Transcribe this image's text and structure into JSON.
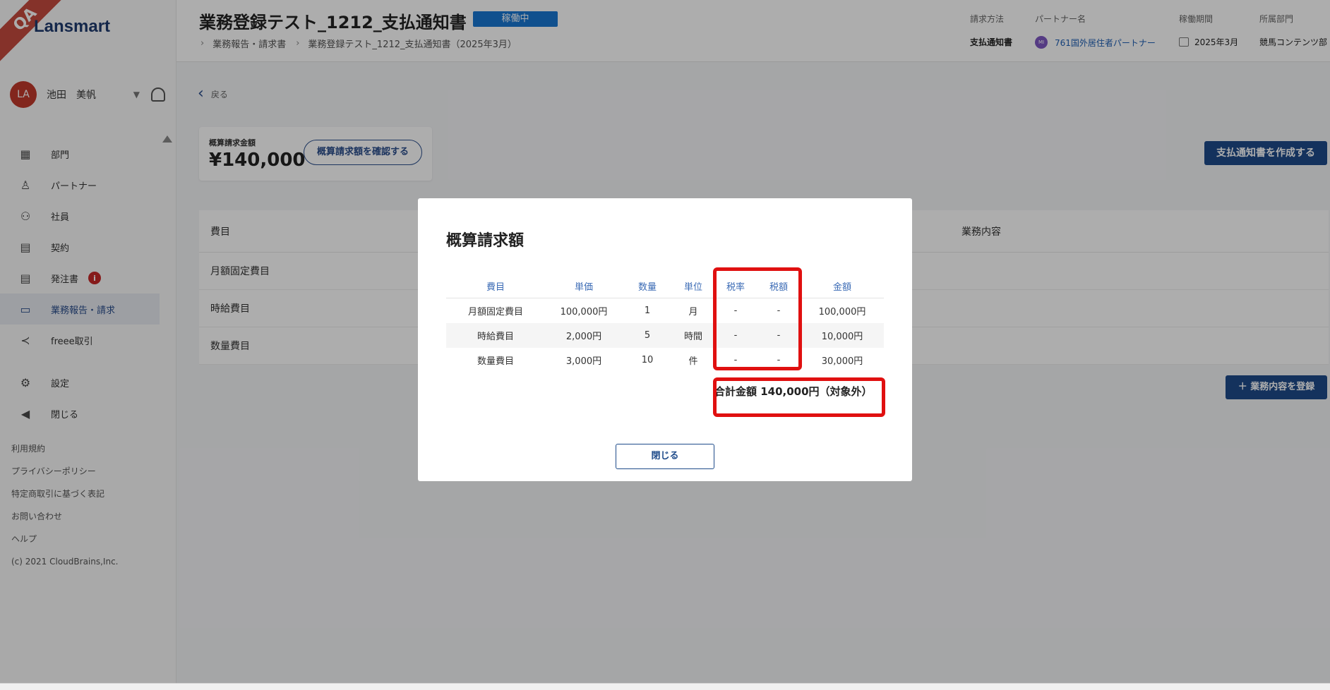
{
  "brand": {
    "ribbon": "QA",
    "name": "Lansmart"
  },
  "user": {
    "avatar": "LA",
    "name": "池田　美帆"
  },
  "nav": [
    {
      "label": "部門",
      "icon": "building-icon"
    },
    {
      "label": "パートナー",
      "icon": "person-icon"
    },
    {
      "label": "社員",
      "icon": "people-icon"
    },
    {
      "label": "契約",
      "icon": "document-icon"
    },
    {
      "label": "発注書",
      "icon": "document-icon",
      "badge": "i"
    },
    {
      "label": "業務報告・請求",
      "icon": "folder-icon",
      "active": true
    },
    {
      "label": "freee取引",
      "icon": "freee-icon"
    }
  ],
  "nav_bottom": [
    {
      "label": "設定",
      "icon": "gear-icon"
    },
    {
      "label": "閉じる",
      "icon": "collapse-icon"
    }
  ],
  "footer_links": [
    "利用規約",
    "プライバシーポリシー",
    "特定商取引に基づく表記",
    "お問い合わせ",
    "ヘルプ",
    "(c) 2021 CloudBrains,Inc."
  ],
  "header": {
    "title": "業務登録テスト_1212_支払通知書",
    "status": "稼働中",
    "breadcrumb": [
      "業務報告・請求書",
      "業務登録テスト_1212_支払通知書（2025年3月）"
    ],
    "meta": {
      "billing_method_label": "請求方法",
      "billing_method": "支払通知書",
      "partner_label": "パートナー名",
      "partner_avatar": "MI",
      "partner": "761国外居住者パートナー",
      "period_label": "稼働期間",
      "period": "2025年3月",
      "dept_label": "所属部門",
      "dept": "競馬コンテンツ部"
    }
  },
  "main": {
    "back": "戻る",
    "estimate_label": "概算請求金額",
    "estimate_amount": "¥140,000",
    "estimate_button": "概算請求額を確認する",
    "create_button": "支払通知書を作成する",
    "table_headers": [
      "費目",
      "業務内容"
    ],
    "rows": [
      "月額固定費目",
      "時給費目",
      "数量費目"
    ],
    "add_button": "＋ 業務内容を登録"
  },
  "modal": {
    "title": "概算請求額",
    "headers": [
      "費目",
      "単価",
      "数量",
      "単位",
      "税率",
      "税額",
      "金額"
    ],
    "rows": [
      [
        "月額固定費目",
        "100,000円",
        "1",
        "月",
        "-",
        "-",
        "100,000円"
      ],
      [
        "時給費目",
        "2,000円",
        "5",
        "時間",
        "-",
        "-",
        "10,000円"
      ],
      [
        "数量費目",
        "3,000円",
        "10",
        "件",
        "-",
        "-",
        "30,000円"
      ]
    ],
    "total": "合計金額  140,000円（対象外）",
    "close": "閉じる"
  },
  "colors": {
    "accent": "#1e4b8a",
    "status": "#1976d2",
    "highlight": "#e01010"
  }
}
